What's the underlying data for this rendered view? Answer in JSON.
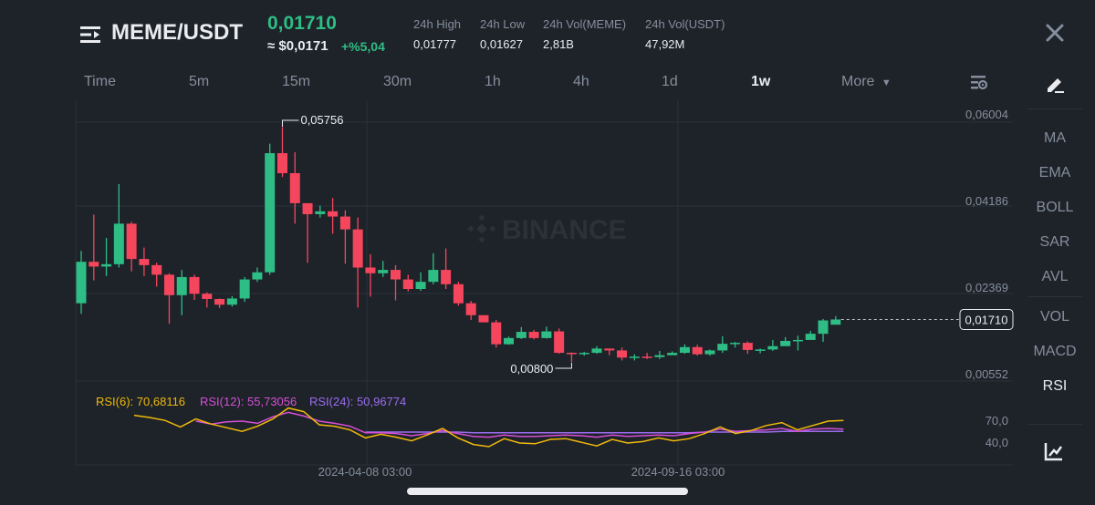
{
  "header": {
    "pair": "MEME/USDT",
    "last_price": "0,01710",
    "approx_usd": "≈ $0,0171",
    "change": "+%5,04",
    "stats": [
      {
        "label": "24h High",
        "value": "0,01777"
      },
      {
        "label": "24h Low",
        "value": "0,01627"
      },
      {
        "label": "24h Vol(MEME)",
        "value": "2,81B"
      },
      {
        "label": "24h Vol(USDT)",
        "value": "47,92M"
      }
    ]
  },
  "toolbar": {
    "timeframes": [
      "Time",
      "5m",
      "15m",
      "30m",
      "1h",
      "4h",
      "1d",
      "1w"
    ],
    "active": "1w",
    "more_label": "More"
  },
  "indicators": {
    "main": [
      "MA",
      "EMA",
      "BOLL",
      "SAR",
      "AVL"
    ],
    "sub": [
      "VOL",
      "MACD",
      "RSI"
    ],
    "active": "RSI"
  },
  "watermark": "BINANCE",
  "colors": {
    "up": "#2ebd85",
    "down": "#f6465d",
    "bg": "#1e2329",
    "rsi6": "#f0b90b",
    "rsi12": "#d64fd6",
    "rsi24": "#9b6cf0"
  },
  "chart_data": {
    "type": "candlestick",
    "y_ticks": [
      "0,06004",
      "0,04186",
      "0,02369",
      "0,00552"
    ],
    "y_range": [
      0.00552,
      0.06004
    ],
    "price_tag": "0,01710",
    "current_price": 0.0171,
    "high_marker": {
      "value": 0.05756,
      "label": "0,05756"
    },
    "low_marker": {
      "value": 0.008,
      "label": "0,00800"
    },
    "x_ticks": [
      "2024-04-08 03:00",
      "2024-09-16 03:00"
    ],
    "candles": [
      [
        0.0205,
        0.0292,
        0.0315,
        0.0183
      ],
      [
        0.0292,
        0.0282,
        0.0391,
        0.0253
      ],
      [
        0.0282,
        0.0287,
        0.0342,
        0.0262
      ],
      [
        0.0287,
        0.0372,
        0.0455,
        0.028
      ],
      [
        0.0372,
        0.0298,
        0.0376,
        0.0272
      ],
      [
        0.0298,
        0.0285,
        0.0322,
        0.0262
      ],
      [
        0.0285,
        0.0265,
        0.029,
        0.024
      ],
      [
        0.0265,
        0.0222,
        0.0268,
        0.0162
      ],
      [
        0.0222,
        0.026,
        0.0275,
        0.018
      ],
      [
        0.026,
        0.0225,
        0.0265,
        0.0212
      ],
      [
        0.0225,
        0.0214,
        0.0228,
        0.0196
      ],
      [
        0.0214,
        0.0202,
        0.0215,
        0.0195
      ],
      [
        0.0202,
        0.0215,
        0.022,
        0.0198
      ],
      [
        0.0215,
        0.0255,
        0.026,
        0.0208
      ],
      [
        0.0255,
        0.027,
        0.028,
        0.025
      ],
      [
        0.027,
        0.052,
        0.054,
        0.0265
      ],
      [
        0.052,
        0.0478,
        0.0575,
        0.047
      ],
      [
        0.0478,
        0.0415,
        0.0522,
        0.0372
      ],
      [
        0.0415,
        0.0392,
        0.0402,
        0.029
      ],
      [
        0.0392,
        0.0398,
        0.041,
        0.0385
      ],
      [
        0.0398,
        0.0387,
        0.0426,
        0.0351
      ],
      [
        0.0387,
        0.036,
        0.04,
        0.0288
      ],
      [
        0.036,
        0.028,
        0.0385,
        0.0196
      ],
      [
        0.028,
        0.0268,
        0.0308,
        0.0219
      ],
      [
        0.0268,
        0.0275,
        0.0294,
        0.026
      ],
      [
        0.0275,
        0.0255,
        0.0285,
        0.0211
      ],
      [
        0.0255,
        0.0235,
        0.0265,
        0.023
      ],
      [
        0.0235,
        0.025,
        0.027,
        0.0231
      ],
      [
        0.025,
        0.0275,
        0.031,
        0.0245
      ],
      [
        0.0275,
        0.0245,
        0.032,
        0.0235
      ],
      [
        0.0245,
        0.0205,
        0.025,
        0.02
      ],
      [
        0.0205,
        0.018,
        0.021,
        0.017
      ],
      [
        0.018,
        0.0165,
        0.0175,
        0.0165
      ],
      [
        0.0165,
        0.0119,
        0.017,
        0.0112
      ],
      [
        0.0119,
        0.0132,
        0.0135,
        0.0118
      ],
      [
        0.0132,
        0.0145,
        0.0155,
        0.013
      ],
      [
        0.0145,
        0.0132,
        0.0149,
        0.0129
      ],
      [
        0.0132,
        0.0146,
        0.0156,
        0.0131
      ],
      [
        0.0146,
        0.0101,
        0.0152,
        0.0099
      ],
      [
        0.0101,
        0.01,
        0.0102,
        0.0081
      ],
      [
        0.01,
        0.0101,
        0.0103,
        0.0095
      ],
      [
        0.0101,
        0.011,
        0.0115,
        0.0099
      ],
      [
        0.011,
        0.0106,
        0.0109,
        0.0096
      ],
      [
        0.0106,
        0.0091,
        0.0112,
        0.0085
      ],
      [
        0.0091,
        0.0093,
        0.0098,
        0.0085
      ],
      [
        0.0093,
        0.0092,
        0.0101,
        0.0088
      ],
      [
        0.0092,
        0.0096,
        0.0105,
        0.0088
      ],
      [
        0.0096,
        0.0101,
        0.0104,
        0.0098
      ],
      [
        0.0101,
        0.0113,
        0.0119,
        0.0099
      ],
      [
        0.0113,
        0.0098,
        0.0118,
        0.0095
      ],
      [
        0.0098,
        0.0106,
        0.0108,
        0.0095
      ],
      [
        0.0106,
        0.012,
        0.0136,
        0.0101
      ],
      [
        0.012,
        0.0122,
        0.0124,
        0.0112
      ],
      [
        0.0122,
        0.0107,
        0.0125,
        0.0099
      ],
      [
        0.0107,
        0.0108,
        0.011,
        0.01
      ],
      [
        0.0108,
        0.0115,
        0.0128,
        0.0105
      ],
      [
        0.0115,
        0.0126,
        0.0134,
        0.0116
      ],
      [
        0.0126,
        0.0128,
        0.0137,
        0.0106
      ],
      [
        0.0128,
        0.0141,
        0.0147,
        0.0138
      ],
      [
        0.0141,
        0.0169,
        0.0172,
        0.0124
      ],
      [
        0.016,
        0.0171,
        0.0178,
        0.0168
      ]
    ],
    "rsi_ticks": [
      "70,0",
      "40,0"
    ],
    "rsi": {
      "rsi6": {
        "label": "RSI(6): 70,68116",
        "values": [
          78,
          75,
          71,
          62,
          73,
          66,
          61,
          56,
          63,
          73,
          88,
          83,
          65,
          63,
          58,
          47,
          52,
          48,
          43,
          51,
          60,
          47,
          38,
          35,
          46,
          40,
          39,
          45,
          46,
          41,
          36,
          45,
          40,
          42,
          47,
          43,
          46,
          53,
          62,
          53,
          57,
          64,
          68,
          58,
          64,
          70,
          71
        ]
      },
      "rsi12": {
        "label": "RSI(12): 55,73056",
        "values": [
          null,
          null,
          null,
          null,
          70,
          66,
          69,
          70,
          67,
          76,
          82,
          77,
          70,
          67,
          63,
          54,
          54,
          53,
          50,
          53,
          57,
          53,
          49,
          48,
          51,
          49,
          49,
          50,
          51,
          50,
          48,
          51,
          49,
          50,
          51,
          50,
          53,
          55,
          59,
          56,
          57,
          58,
          60,
          56,
          59,
          60,
          59
        ]
      },
      "rsi24": {
        "label": "RSI(24): 50,96774",
        "values": [
          null,
          null,
          null,
          null,
          null,
          null,
          null,
          null,
          null,
          null,
          null,
          null,
          null,
          null,
          null,
          55,
          55,
          55,
          55,
          55,
          55,
          55,
          54,
          54,
          54,
          54,
          54,
          54,
          54,
          54,
          54,
          54,
          54,
          54,
          54,
          54,
          54,
          55,
          55,
          55,
          55,
          55,
          56,
          56,
          56,
          56,
          56
        ]
      }
    }
  }
}
